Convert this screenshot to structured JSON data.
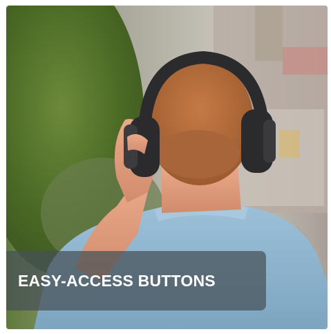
{
  "banner": {
    "caption": "EASY-ACCESS BUTTONS",
    "image_subject": "man-wearing-over-ear-headphones-back-view"
  },
  "colors": {
    "caption_overlay": "#46505880",
    "caption_text": "#ffffff",
    "shirt": "#8fb6cf",
    "hair": "#b3693a",
    "headphones": "#2b2b2d",
    "foliage": "#4f6a2c"
  }
}
